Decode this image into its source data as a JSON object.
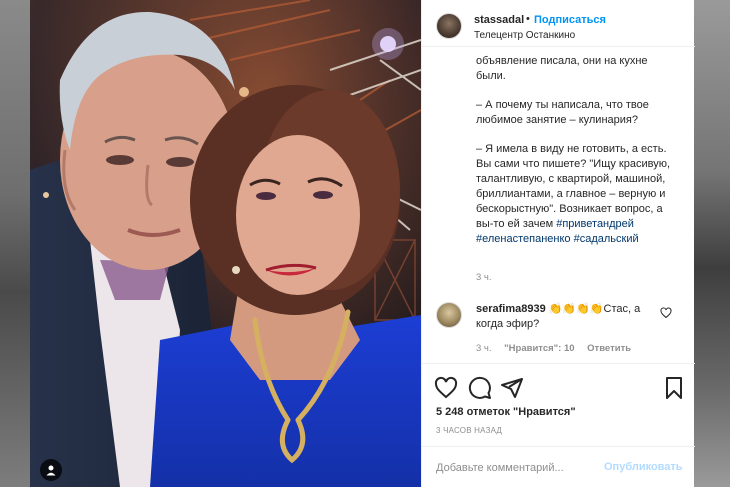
{
  "post": {
    "username": "stassadal",
    "separator": "•",
    "follow_label": "Подписаться",
    "location": "Телецентр Останкино"
  },
  "caption": {
    "lines_1": "объявление писала, они на кухне были.",
    "lines_2": "– А почему ты написала, что твое любимое занятие – кулинария?",
    "lines_3": "– Я имела в виду не готовить, а есть. Вы сами что пишете? \"Ищу красивую, талантливую, с квартирой, машиной, бриллиантами, а главное – верную и бескорыстную\". Возникает вопрос, а вы-то ей зачем",
    "hashtag_1": "#приветандрей",
    "hashtag_2": "#еленастепаненко",
    "hashtag_3": "#садальский",
    "time": "3 ч."
  },
  "comment": {
    "username": "serafima8939",
    "text": "👏👏👏👏Стас, а когда эфир?",
    "time": "3 ч.",
    "likes": "\"Нравится\": 10",
    "reply": "Ответить"
  },
  "actions": {
    "likes_text": "5 248 отметок \"Нравится\"",
    "posted_ago": "3 ЧАСОВ НАЗАД"
  },
  "add_comment": {
    "placeholder": "Добавьте комментарий...",
    "post_label": "Опубликовать"
  },
  "icons": {
    "like": "heart-icon",
    "comment": "comment-icon",
    "share": "paper-plane-icon",
    "save": "bookmark-icon",
    "comment_like": "heart-icon",
    "photo_tag": "user-tag-icon"
  }
}
